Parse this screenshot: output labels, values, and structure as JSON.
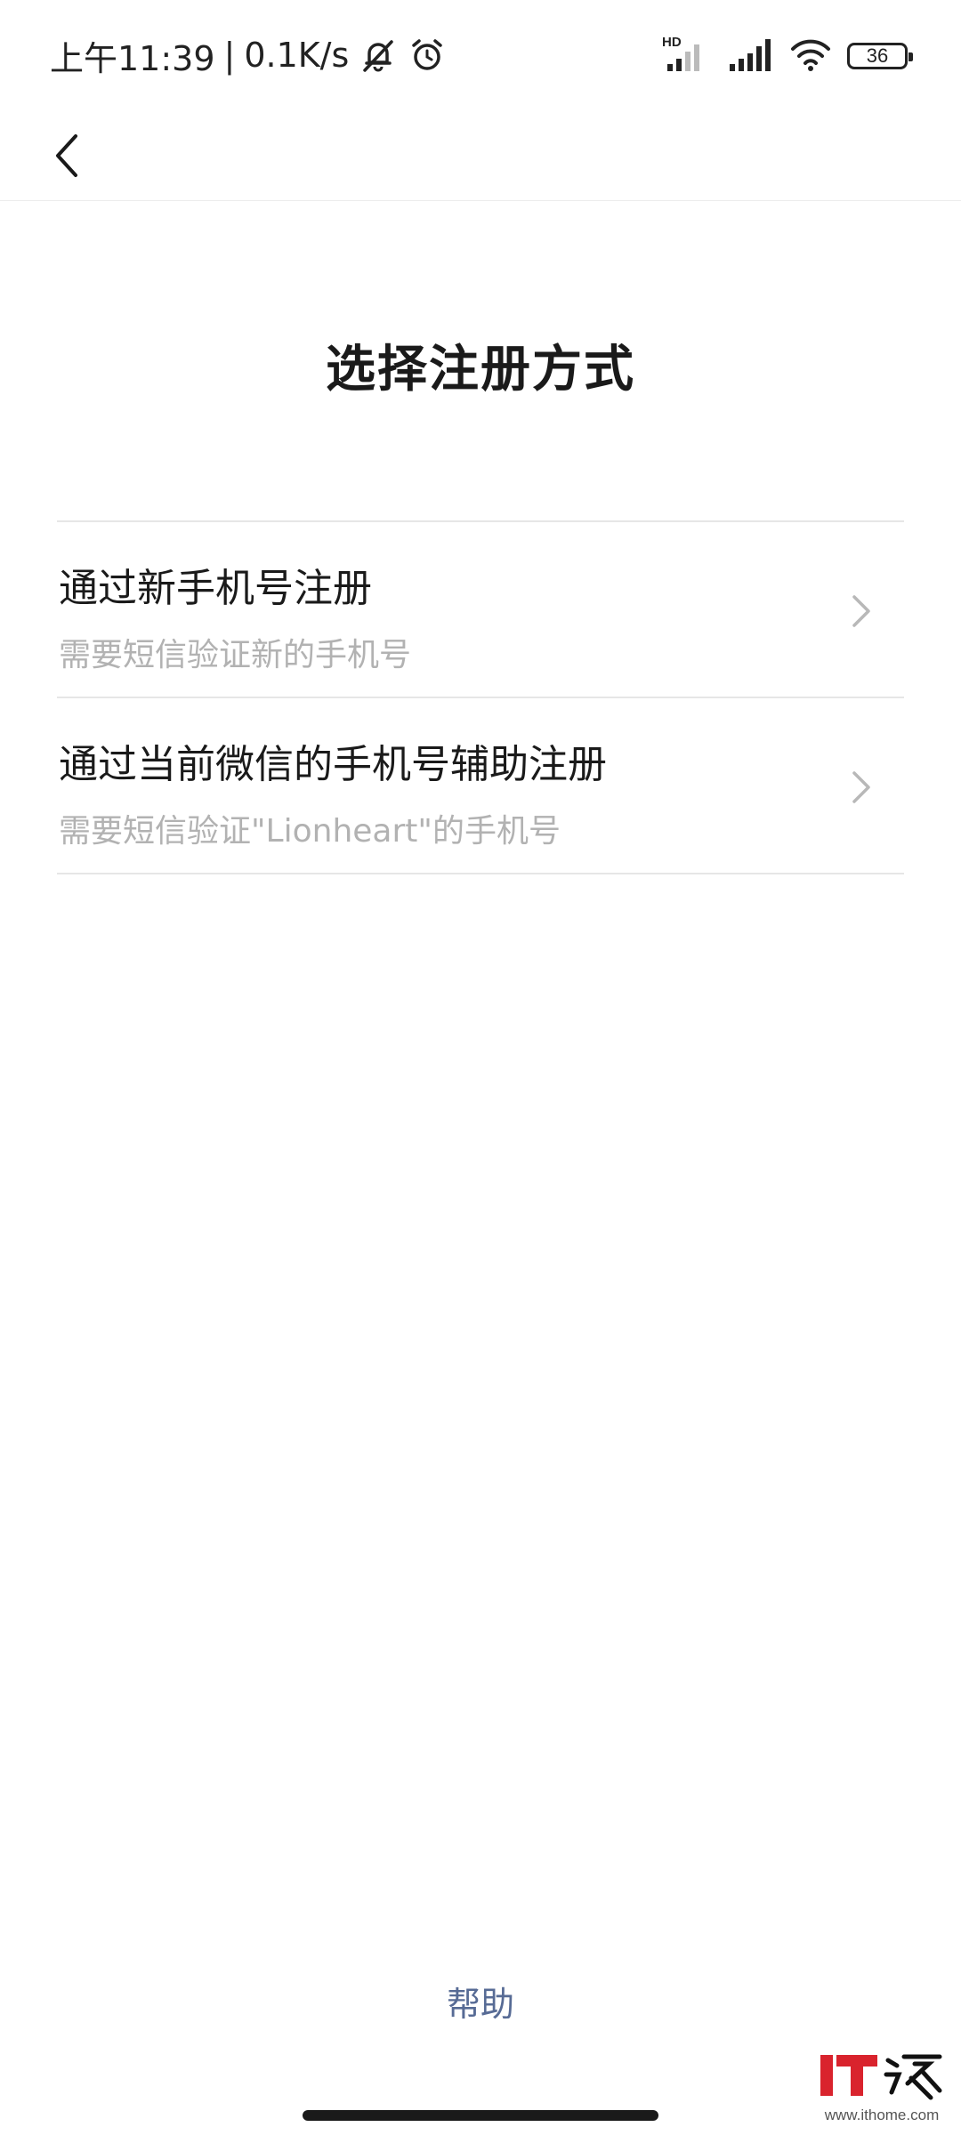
{
  "status_bar": {
    "time": "上午11:39",
    "separator": "|",
    "net_speed": "0.1K/s",
    "network_badge": "HD",
    "battery_level": "36"
  },
  "nav": {
    "back_icon": "chevron-left-icon"
  },
  "page": {
    "title": "选择注册方式"
  },
  "options": [
    {
      "title": "通过新手机号注册",
      "subtitle": "需要短信验证新的手机号"
    },
    {
      "title": "通过当前微信的手机号辅助注册",
      "subtitle": "需要短信验证\"Lionheart\"的手机号"
    }
  ],
  "footer": {
    "help_label": "帮助"
  },
  "watermark": {
    "url": "www.ithome.com"
  },
  "colors": {
    "link": "#576b95",
    "subtitle": "#b2b2b2",
    "divider": "#e6e6e6",
    "watermark_red": "#d9232d"
  }
}
